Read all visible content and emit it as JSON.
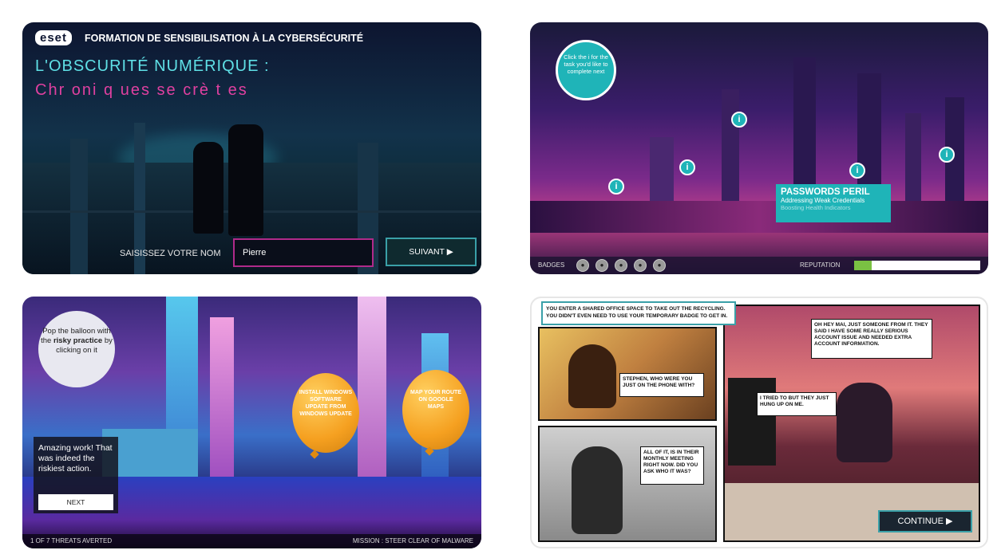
{
  "panel1": {
    "logo": "eset",
    "header": "FORMATION DE SENSIBILISATION À LA CYBERSÉCURITÉ",
    "title": "L'OBSCURITÉ NUMÉRIQUE :",
    "subtitle": "Chr oni q ues se crè t es",
    "name_label": "SAISISSEZ VOTRE NOM",
    "name_value": "Pierre",
    "next_label": "SUIVANT ▶"
  },
  "panel2": {
    "tip": "Click the i for the task you'd like to complete next",
    "card_title": "PASSWORDS PERIL",
    "card_subtitle": "Addressing Weak Credentials",
    "card_subtitle2": "Boosting Health Indicators",
    "badges_label": "BADGES",
    "reputation_label": "REPUTATION",
    "reputation_value": 0.14,
    "info_glyph": "i"
  },
  "panel3": {
    "tip_line1": "Pop the balloon with the",
    "tip_bold": "risky practice",
    "tip_line2": "by clicking on it",
    "balloon1": "INSTALL WINDOWS SOFTWARE UPDATE FROM WINDOWS UPDATE",
    "balloon2": "MAP YOUR ROUTE ON GOOGLE MAPS",
    "message": "Amazing work! That was indeed the riskiest action.",
    "next_label": "NEXT",
    "threat_count": "1 OF 7 THREATS AVERTED",
    "mission": "MISSION : STEER CLEAR OF MALWARE"
  },
  "panel4": {
    "caption": "YOU ENTER A SHARED OFFICE SPACE TO TAKE OUT THE RECYCLING. YOU DIDN'T EVEN NEED TO USE YOUR TEMPORARY BADGE TO GET IN.",
    "bubble1": "STEPHEN, WHO WERE YOU JUST ON THE PHONE WITH?",
    "bubble2": "OH HEY MAI, JUST SOMEONE FROM IT. THEY SAID I HAVE SOME REALLY SERIOUS ACCOUNT ISSUE AND NEEDED EXTRA ACCOUNT INFORMATION.",
    "bubble3": "I TRIED TO BUT THEY JUST HUNG UP ON ME.",
    "bubble4": "ALL OF IT, IS IN THEIR MONTHLY MEETING RIGHT NOW. DID YOU ASK WHO IT WAS?",
    "continue_label": "CONTINUE ▶"
  }
}
